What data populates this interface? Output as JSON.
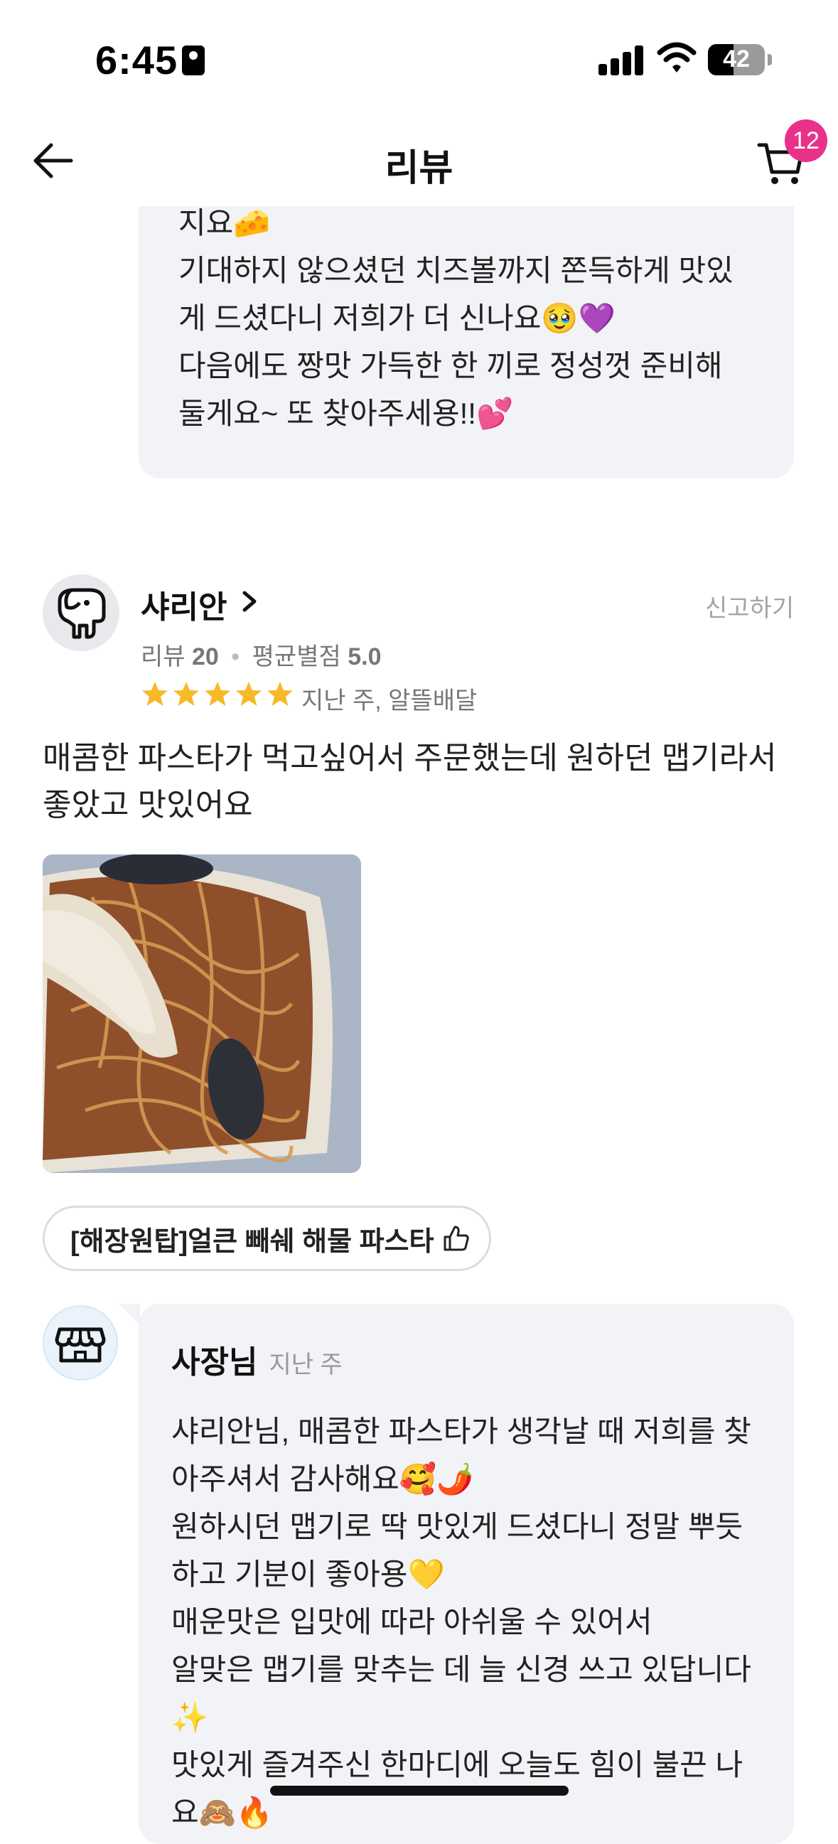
{
  "status_bar": {
    "time": "6:45",
    "battery": "42"
  },
  "nav": {
    "title": "리뷰",
    "cart_count": "12"
  },
  "previous_reply": {
    "text": "지요🧀\n기대하지 않으셨던 치즈볼까지 쫀득하게 맛있게 드셨다니 저희가 더 신나요🥹💜\n다음에도 짱맛 가득한 한 끼로 정성껏 준비해 둘게요~ 또 찾아주세용!!💕"
  },
  "review": {
    "reviewer_name": "샤리안",
    "report_label": "신고하기",
    "review_count_label": "리뷰",
    "review_count": "20",
    "avg_rating_label": "평균별점",
    "avg_rating": "5.0",
    "rating": 5,
    "date_method": "지난 주, 알뜰배달",
    "text": "매콤한 파스타가 먹고싶어서 주문했는데 원하던 맵기라서 좋았고 맛있어요",
    "menu_item": "[해장원탑]얼큰 빼쉐 해물 파스타"
  },
  "owner_reply": {
    "name": "사장님",
    "date": "지난 주",
    "text": "샤리안님, 매콤한 파스타가 생각날 때 저희를 찾아주셔서 감사해요🥰🌶️\n원하시던 맵기로 딱 맛있게 드셨다니 정말 뿌듯하고 기분이 좋아용💛\n매운맛은 입맛에 따라 아쉬울 수 있어서\n알맞은 맵기를 맞추는 데 늘 신경 쓰고 있답니다✨\n맛있게 즐겨주신 한마디에 오늘도 힘이 불끈 나요🙈🔥"
  },
  "colors": {
    "badge": "#e8328a",
    "star": "#f7b928",
    "bubble": "#f2f3f6"
  }
}
